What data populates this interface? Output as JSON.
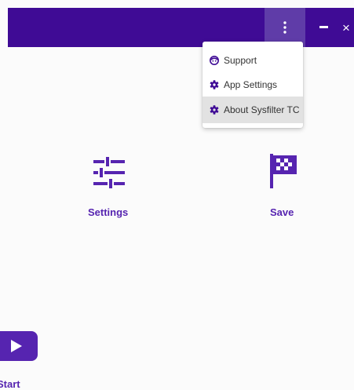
{
  "colors": {
    "titlebar": "#3f0b95",
    "titlebar_active_button": "#5f3ca8",
    "accent": "#5624b0",
    "background": "#fbfbfb"
  },
  "window_controls": {
    "menu_icon": "kebab-vertical-icon",
    "minimize_icon": "minimize-icon",
    "close_label": "×"
  },
  "menu": {
    "items": [
      {
        "label": "Support",
        "icon": "support-face-icon"
      },
      {
        "label": "App Settings",
        "icon": "gear-icon"
      },
      {
        "label": "About Sysfilter TC",
        "icon": "gear-icon"
      }
    ]
  },
  "main": {
    "tiles": [
      {
        "label": "Settings",
        "icon": "sliders-icon"
      },
      {
        "label": "Save",
        "icon": "checkered-flag-icon"
      },
      {
        "label": "Start",
        "icon": "play-icon"
      }
    ]
  }
}
